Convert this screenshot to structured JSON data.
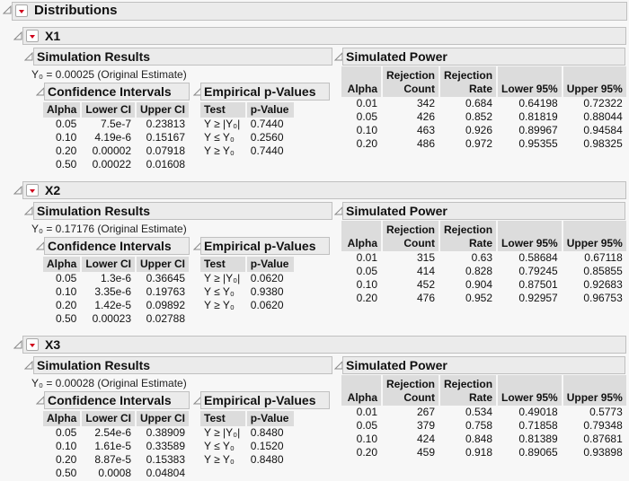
{
  "report": {
    "title": "Distributions",
    "variables": [
      {
        "name": "X1",
        "simulation_results_title": "Simulation Results",
        "y0_text": "Y₀ = 0.00025 (Original Estimate)",
        "confidence_intervals": {
          "title": "Confidence Intervals",
          "headers": [
            "Alpha",
            "Lower CI",
            "Upper CI"
          ],
          "rows": [
            [
              "0.05",
              "7.5e-7",
              "0.23813"
            ],
            [
              "0.10",
              "4.19e-6",
              "0.15167"
            ],
            [
              "0.20",
              "0.00002",
              "0.07918"
            ],
            [
              "0.50",
              "0.00022",
              "0.01608"
            ]
          ]
        },
        "empirical_p_values": {
          "title": "Empirical p-Values",
          "headers": [
            "Test",
            "p-Value"
          ],
          "rows": [
            [
              "Y ≥ |Y₀|",
              "0.7440"
            ],
            [
              "Y ≤ Y₀",
              "0.2560"
            ],
            [
              "Y ≥ Y₀",
              "0.7440"
            ]
          ]
        },
        "simulated_power": {
          "title": "Simulated Power",
          "headers": [
            "Alpha",
            "Rejection Count",
            "Rejection Rate",
            "Lower 95%",
            "Upper 95%"
          ],
          "rows": [
            [
              "0.01",
              "342",
              "0.684",
              "0.64198",
              "0.72322"
            ],
            [
              "0.05",
              "426",
              "0.852",
              "0.81819",
              "0.88044"
            ],
            [
              "0.10",
              "463",
              "0.926",
              "0.89967",
              "0.94584"
            ],
            [
              "0.20",
              "486",
              "0.972",
              "0.95355",
              "0.98325"
            ]
          ]
        }
      },
      {
        "name": "X2",
        "simulation_results_title": "Simulation Results",
        "y0_text": "Y₀ = 0.17176 (Original Estimate)",
        "confidence_intervals": {
          "title": "Confidence Intervals",
          "headers": [
            "Alpha",
            "Lower CI",
            "Upper CI"
          ],
          "rows": [
            [
              "0.05",
              "1.3e-6",
              "0.36645"
            ],
            [
              "0.10",
              "3.35e-6",
              "0.19763"
            ],
            [
              "0.20",
              "1.42e-5",
              "0.09892"
            ],
            [
              "0.50",
              "0.00023",
              "0.02788"
            ]
          ]
        },
        "empirical_p_values": {
          "title": "Empirical p-Values",
          "headers": [
            "Test",
            "p-Value"
          ],
          "rows": [
            [
              "Y ≥ |Y₀|",
              "0.0620"
            ],
            [
              "Y ≤ Y₀",
              "0.9380"
            ],
            [
              "Y ≥ Y₀",
              "0.0620"
            ]
          ]
        },
        "simulated_power": {
          "title": "Simulated Power",
          "headers": [
            "Alpha",
            "Rejection Count",
            "Rejection Rate",
            "Lower 95%",
            "Upper 95%"
          ],
          "rows": [
            [
              "0.01",
              "315",
              "0.63",
              "0.58684",
              "0.67118"
            ],
            [
              "0.05",
              "414",
              "0.828",
              "0.79245",
              "0.85855"
            ],
            [
              "0.10",
              "452",
              "0.904",
              "0.87501",
              "0.92683"
            ],
            [
              "0.20",
              "476",
              "0.952",
              "0.92957",
              "0.96753"
            ]
          ]
        }
      },
      {
        "name": "X3",
        "simulation_results_title": "Simulation Results",
        "y0_text": "Y₀ = 0.00028 (Original Estimate)",
        "confidence_intervals": {
          "title": "Confidence Intervals",
          "headers": [
            "Alpha",
            "Lower CI",
            "Upper CI"
          ],
          "rows": [
            [
              "0.05",
              "2.54e-6",
              "0.38909"
            ],
            [
              "0.10",
              "1.61e-5",
              "0.33589"
            ],
            [
              "0.20",
              "8.87e-5",
              "0.15383"
            ],
            [
              "0.50",
              "0.0008",
              "0.04804"
            ]
          ]
        },
        "empirical_p_values": {
          "title": "Empirical p-Values",
          "headers": [
            "Test",
            "p-Value"
          ],
          "rows": [
            [
              "Y ≥ |Y₀|",
              "0.8480"
            ],
            [
              "Y ≤ Y₀",
              "0.1520"
            ],
            [
              "Y ≥ Y₀",
              "0.8480"
            ]
          ]
        },
        "simulated_power": {
          "title": "Simulated Power",
          "headers": [
            "Alpha",
            "Rejection Count",
            "Rejection Rate",
            "Lower 95%",
            "Upper 95%"
          ],
          "rows": [
            [
              "0.01",
              "267",
              "0.534",
              "0.49018",
              "0.5773"
            ],
            [
              "0.05",
              "379",
              "0.758",
              "0.71858",
              "0.79348"
            ],
            [
              "0.10",
              "424",
              "0.848",
              "0.81389",
              "0.87681"
            ],
            [
              "0.20",
              "459",
              "0.918",
              "0.89065",
              "0.93898"
            ]
          ]
        }
      }
    ]
  },
  "colors": {
    "menu_triangle": "#d0021b",
    "header_bg": "#ebebeb",
    "column_header_bg": "#dcdcdc"
  }
}
